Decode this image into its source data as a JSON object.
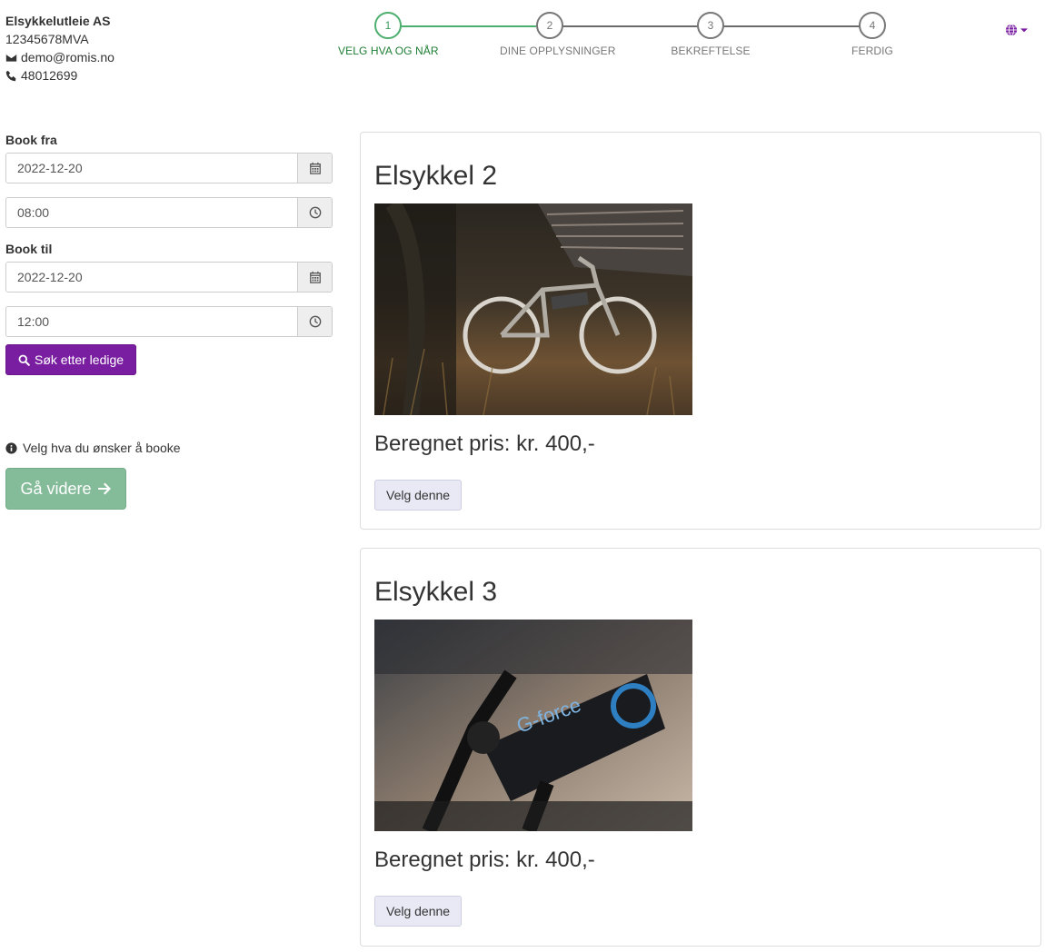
{
  "company": {
    "name": "Elsykkelutleie AS",
    "org_number": "12345678MVA",
    "email": "demo@romis.no",
    "phone": "48012699"
  },
  "stepper": {
    "steps": [
      {
        "number": "1",
        "label": "VELG HVA OG NÅR"
      },
      {
        "number": "2",
        "label": "DINE OPPLYSNINGER"
      },
      {
        "number": "3",
        "label": "BEKREFTELSE"
      },
      {
        "number": "4",
        "label": "FERDIG"
      }
    ],
    "active_step": 1
  },
  "form": {
    "book_from_label": "Book fra",
    "book_from_date": "2022-12-20",
    "book_from_time": "08:00",
    "book_to_label": "Book til",
    "book_to_date": "2022-12-20",
    "book_to_time": "12:00",
    "search_button": "Søk etter ledige"
  },
  "hint": "Velg hva du ønsker å booke",
  "next_button": "Gå videre",
  "products": [
    {
      "name": "Elsykkel 2",
      "price": "Beregnet pris: kr. 400,-",
      "select_label": "Velg denne"
    },
    {
      "name": "Elsykkel 3",
      "price": "Beregnet pris: kr. 400,-",
      "select_label": "Velg denne"
    }
  ],
  "colors": {
    "primary": "#7a1ea1",
    "success": "#4caf6e",
    "next_button": "#84bb99"
  }
}
